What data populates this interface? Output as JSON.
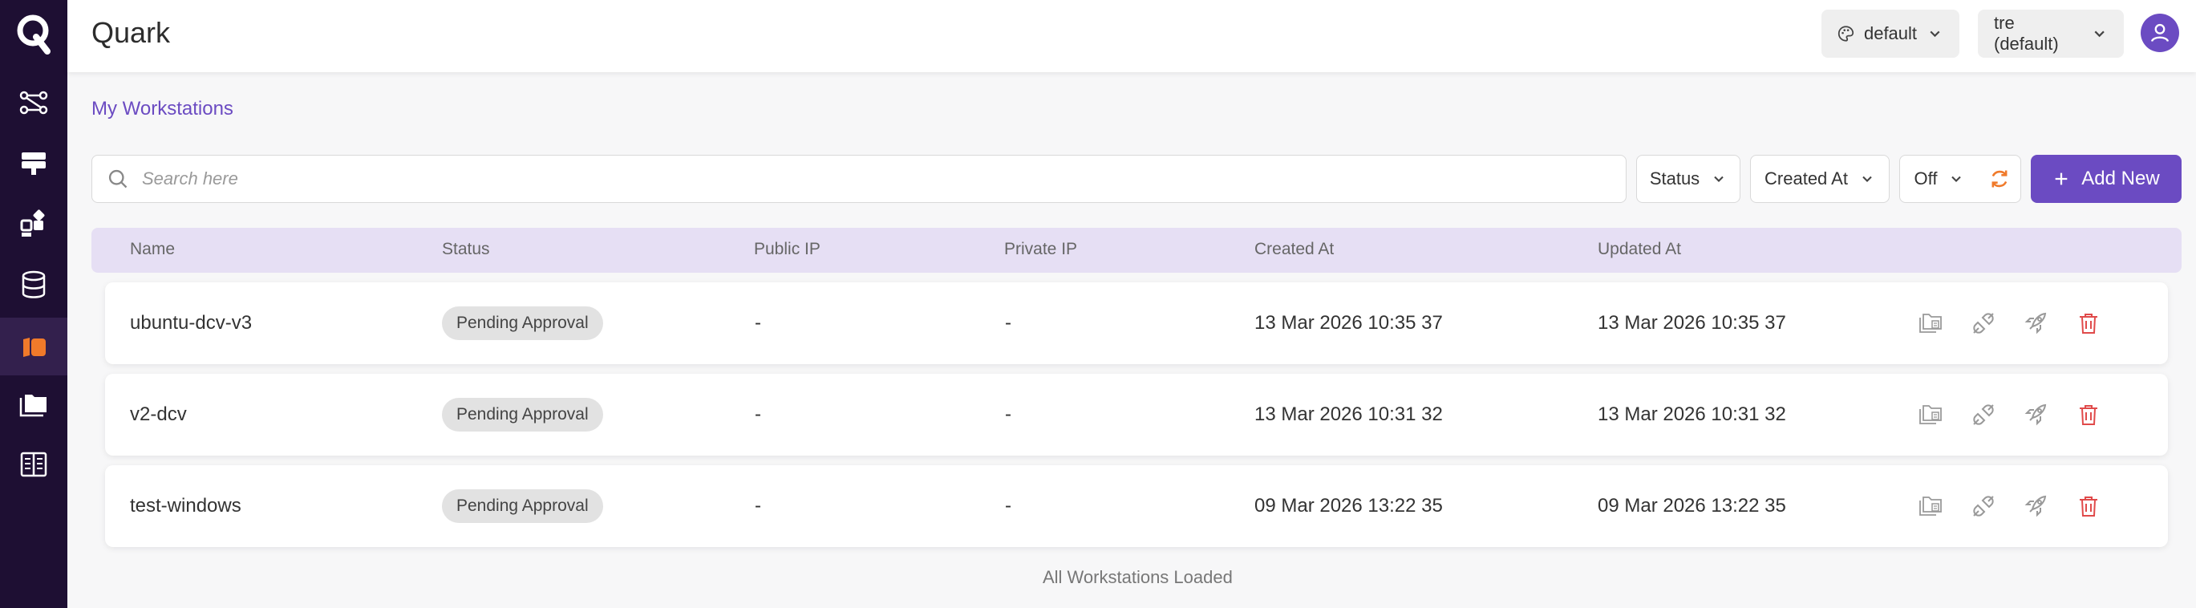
{
  "app": {
    "title": "Quark"
  },
  "header": {
    "theme_label": "default",
    "project_label": "tre (default)"
  },
  "breadcrumb": "My Workstations",
  "toolbar": {
    "search_placeholder": "Search here",
    "status_filter": "Status",
    "created_filter": "Created At",
    "auto_refresh": "Off",
    "add_label": "Add New"
  },
  "table": {
    "columns": [
      "Name",
      "Status",
      "Public IP",
      "Private IP",
      "Created At",
      "Updated At"
    ],
    "rows": [
      {
        "name": "ubuntu-dcv-v3",
        "status": "Pending Approval",
        "public_ip": "-",
        "private_ip": "-",
        "created": "13 Mar 2026 10:35 37",
        "updated": "13 Mar 2026 10:35 37"
      },
      {
        "name": "v2-dcv",
        "status": "Pending Approval",
        "public_ip": "-",
        "private_ip": "-",
        "created": "13 Mar 2026 10:31 32",
        "updated": "13 Mar 2026 10:31 32"
      },
      {
        "name": "test-windows",
        "status": "Pending Approval",
        "public_ip": "-",
        "private_ip": "-",
        "created": "09 Mar 2026 13:22 35",
        "updated": "09 Mar 2026 13:22 35"
      }
    ]
  },
  "footer": "All Workstations Loaded",
  "colors": {
    "sidebar": "#1e0f33",
    "accent": "#6b4bc2",
    "header_row": "#e6dff4",
    "delete": "#e04a4a",
    "refresh": "#f07a2a",
    "active_nav_icon": "#f07a2a"
  },
  "icons": {
    "nav": [
      "workflow-icon",
      "compute-icon",
      "apps-icon",
      "database-icon",
      "workstation-icon",
      "folder-icon",
      "notebook-icon"
    ],
    "row_actions": [
      "file-details-icon",
      "connect-icon",
      "launch-icon",
      "delete-icon"
    ]
  }
}
